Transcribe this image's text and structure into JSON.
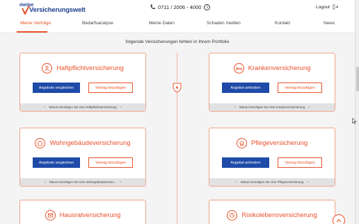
{
  "header": {
    "logo_small": "meine",
    "logo_main": "Versicherungswelt",
    "phone": "0711 / 2006 - 4000",
    "logout_label": "Logout"
  },
  "nav": {
    "items": [
      {
        "label": "Meine Verträge",
        "active": true
      },
      {
        "label": "Bedarfsanalyse",
        "active": false
      },
      {
        "label": "Meine Daten",
        "active": false
      },
      {
        "label": "Schaden melden",
        "active": false
      },
      {
        "label": "Kontakt",
        "active": false
      },
      {
        "label": "News",
        "active": false
      }
    ]
  },
  "main": {
    "subtitle": "folgende Versicherungen fehlen in Ihrem Portfolio"
  },
  "cards": [
    {
      "title": "Haftpflichtversicherung",
      "icon": "liability-icon",
      "primary": "Angebote vergleichen",
      "secondary": "Vertrag hinzufügen",
      "footer": "Warum benötigen Sie eine Haftpflichtversicherung"
    },
    {
      "title": "Krankenversicherung",
      "icon": "bed-icon",
      "primary": "Angebot anfordern",
      "secondary": "Vertrag hinzufügen",
      "footer": "Warum benötigen Sie eine Krankenversicherung"
    },
    {
      "title": "Wohngebäudeversicherung",
      "icon": "house-icon",
      "primary": "Angebote vergleichen",
      "secondary": "Vertrag hinzufügen",
      "footer": "Warum benötigen Sie eine Wohngebäudeversic..."
    },
    {
      "title": "Pflegeversicherung",
      "icon": "care-icon",
      "primary": "Angebot anfordern",
      "secondary": "Vertrag hinzufügen",
      "footer": "Warum benötigen Sie eine Pflegeversicherung"
    },
    {
      "title": "Hausratversicherung",
      "icon": "household-icon"
    },
    {
      "title": "Risikolebensversicherung",
      "icon": "life-icon"
    }
  ],
  "colors": {
    "accent": "#e8512a",
    "primary_button": "#1e4aa8",
    "brand_blue": "#1d3f8f",
    "background": "#f4f4f4",
    "card_border": "#f0a488"
  }
}
